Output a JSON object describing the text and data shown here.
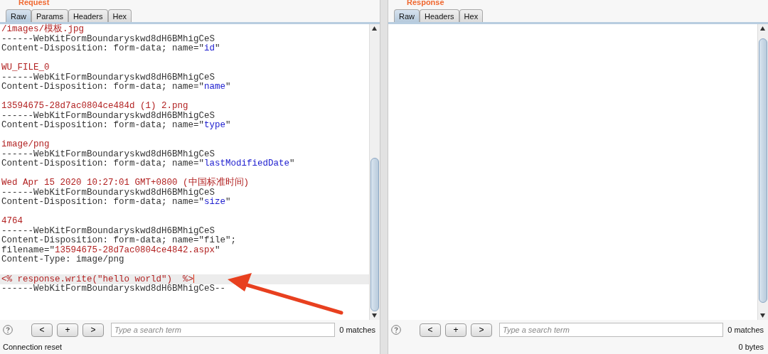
{
  "request": {
    "title": "Request",
    "tabs": [
      {
        "label": "Raw",
        "selected": true
      },
      {
        "label": "Params",
        "selected": false
      },
      {
        "label": "Headers",
        "selected": false
      },
      {
        "label": "Hex",
        "selected": false
      }
    ],
    "blocks": [
      {
        "lines": [
          {
            "highlighted": false,
            "segments": [
              {
                "kind": "value",
                "text": "/images/模板.jpg"
              }
            ]
          },
          {
            "highlighted": false,
            "segments": [
              {
                "kind": "plain",
                "text": "------WebKitFormBoundaryskwd8dH6BMhigCeS"
              }
            ]
          },
          {
            "highlighted": false,
            "segments": [
              {
                "kind": "plain",
                "text": "Content-Disposition: form-data; name=\""
              },
              {
                "kind": "param",
                "text": "id"
              },
              {
                "kind": "plain",
                "text": "\""
              }
            ]
          }
        ]
      },
      {
        "lines": [
          {
            "highlighted": false,
            "segments": [
              {
                "kind": "value",
                "text": "WU_FILE_0"
              }
            ]
          },
          {
            "highlighted": false,
            "segments": [
              {
                "kind": "plain",
                "text": "------WebKitFormBoundaryskwd8dH6BMhigCeS"
              }
            ]
          },
          {
            "highlighted": false,
            "segments": [
              {
                "kind": "plain",
                "text": "Content-Disposition: form-data; name=\""
              },
              {
                "kind": "param",
                "text": "name"
              },
              {
                "kind": "plain",
                "text": "\""
              }
            ]
          }
        ]
      },
      {
        "lines": [
          {
            "highlighted": false,
            "segments": [
              {
                "kind": "value",
                "text": "13594675-28d7ac0804ce484d (1) 2.png"
              }
            ]
          },
          {
            "highlighted": false,
            "segments": [
              {
                "kind": "plain",
                "text": "------WebKitFormBoundaryskwd8dH6BMhigCeS"
              }
            ]
          },
          {
            "highlighted": false,
            "segments": [
              {
                "kind": "plain",
                "text": "Content-Disposition: form-data; name=\""
              },
              {
                "kind": "param",
                "text": "type"
              },
              {
                "kind": "plain",
                "text": "\""
              }
            ]
          }
        ]
      },
      {
        "lines": [
          {
            "highlighted": false,
            "segments": [
              {
                "kind": "value",
                "text": "image/png"
              }
            ]
          },
          {
            "highlighted": false,
            "segments": [
              {
                "kind": "plain",
                "text": "------WebKitFormBoundaryskwd8dH6BMhigCeS"
              }
            ]
          },
          {
            "highlighted": false,
            "segments": [
              {
                "kind": "plain",
                "text": "Content-Disposition: form-data; name=\""
              },
              {
                "kind": "param",
                "text": "lastModifiedDate"
              },
              {
                "kind": "plain",
                "text": "\""
              }
            ]
          }
        ]
      },
      {
        "lines": [
          {
            "highlighted": false,
            "segments": [
              {
                "kind": "value",
                "text": "Wed Apr 15 2020 10:27:01 GMT+0800 (中国标准时间)"
              }
            ]
          },
          {
            "highlighted": false,
            "segments": [
              {
                "kind": "plain",
                "text": "------WebKitFormBoundaryskwd8dH6BMhigCeS"
              }
            ]
          },
          {
            "highlighted": false,
            "segments": [
              {
                "kind": "plain",
                "text": "Content-Disposition: form-data; name=\""
              },
              {
                "kind": "param",
                "text": "size"
              },
              {
                "kind": "plain",
                "text": "\""
              }
            ]
          }
        ]
      },
      {
        "lines": [
          {
            "highlighted": false,
            "segments": [
              {
                "kind": "value",
                "text": "4764"
              }
            ]
          },
          {
            "highlighted": false,
            "segments": [
              {
                "kind": "plain",
                "text": "------WebKitFormBoundaryskwd8dH6BMhigCeS"
              }
            ]
          },
          {
            "highlighted": false,
            "segments": [
              {
                "kind": "plain",
                "text": "Content-Disposition: form-data; name=\"file\";"
              }
            ]
          },
          {
            "highlighted": false,
            "segments": [
              {
                "kind": "plain",
                "text": "filename=\""
              },
              {
                "kind": "value",
                "text": "13594675-28d7ac0804ce4842.aspx"
              },
              {
                "kind": "plain",
                "text": "\""
              }
            ]
          },
          {
            "highlighted": false,
            "segments": [
              {
                "kind": "plain",
                "text": "Content-Type: image/png"
              }
            ]
          }
        ]
      },
      {
        "lines": [
          {
            "highlighted": true,
            "segments": [
              {
                "kind": "value",
                "text": "<% response.write(\"hello world\")  %>"
              }
            ]
          },
          {
            "highlighted": false,
            "segments": [
              {
                "kind": "plain",
                "text": "------WebKitFormBoundaryskwd8dH6BMhigCeS--"
              }
            ]
          }
        ]
      }
    ],
    "search": {
      "buttons": [
        "<",
        "+",
        ">"
      ],
      "placeholder": "Type a search term",
      "matches": "0 matches"
    },
    "status": "Connection reset"
  },
  "response": {
    "title": "Response",
    "tabs": [
      {
        "label": "Raw",
        "selected": true
      },
      {
        "label": "Headers",
        "selected": false
      },
      {
        "label": "Hex",
        "selected": false
      }
    ],
    "search": {
      "buttons": [
        "<",
        "+",
        ">"
      ],
      "placeholder": "Type a search term",
      "matches": "0 matches"
    },
    "status": "0 bytes"
  }
}
